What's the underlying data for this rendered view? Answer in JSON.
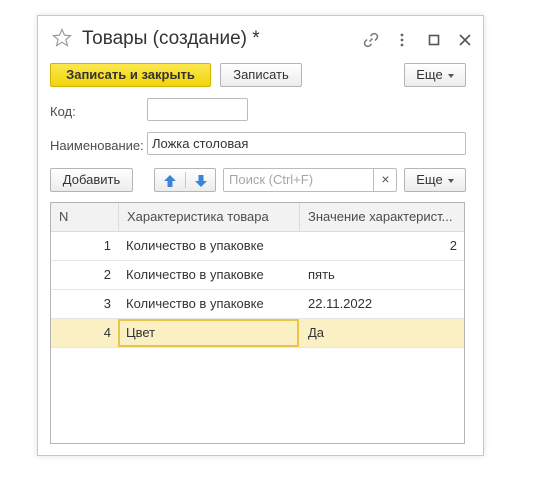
{
  "window": {
    "title": "Товары (создание) *"
  },
  "toolbar": {
    "save_close_label": "Записать и закрыть",
    "save_label": "Записать",
    "more_label": "Еще"
  },
  "fields": {
    "code_label": "Код:",
    "code_value": "",
    "name_label": "Наименование:",
    "name_value": "Ложка столовая"
  },
  "table_toolbar": {
    "add_label": "Добавить",
    "search_placeholder": "Поиск (Ctrl+F)",
    "clear_symbol": "×",
    "more_label": "Еще"
  },
  "table": {
    "columns": [
      "N",
      "Характеристика товара",
      "Значение характерист..."
    ],
    "rows": [
      {
        "n": "1",
        "characteristic": "Количество в упаковке",
        "value": "2"
      },
      {
        "n": "2",
        "characteristic": "Количество в упаковке",
        "value": "пять"
      },
      {
        "n": "3",
        "characteristic": "Количество в упаковке",
        "value": "22.11.2022"
      },
      {
        "n": "4",
        "characteristic": "Цвет",
        "value": "Да"
      }
    ]
  },
  "colors": {
    "primary_button": "#f1d50a",
    "selected_row": "#fbf0c3",
    "arrow_icons": "#3a86d6"
  }
}
